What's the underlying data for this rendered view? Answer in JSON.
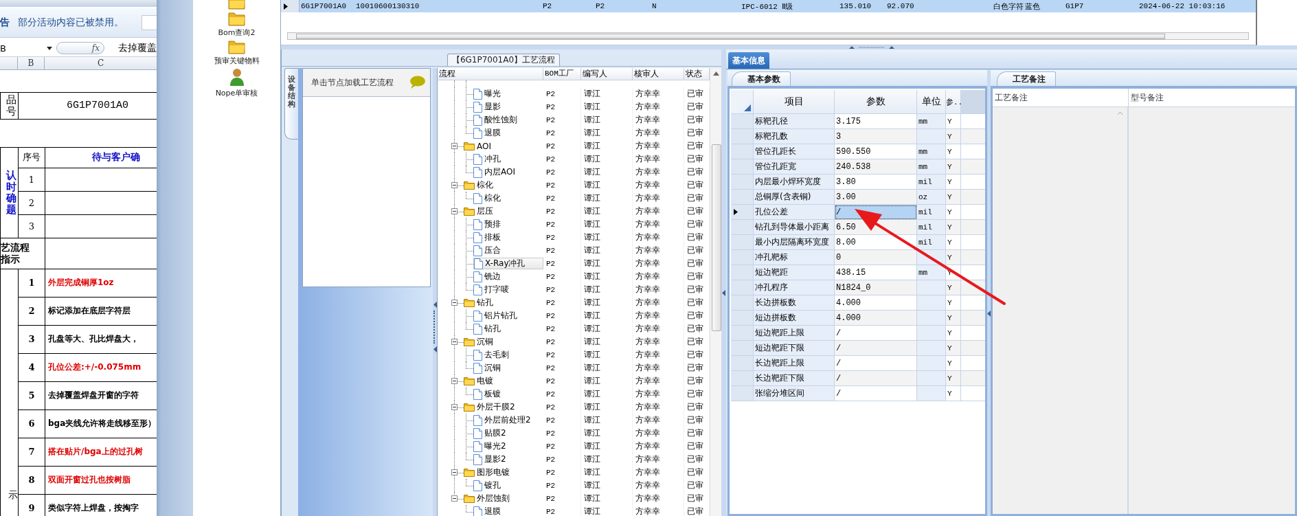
{
  "spreadsheet": {
    "warning": {
      "label": "告",
      "message": "部分活动内容已被禁用。"
    },
    "name_box": "B",
    "function_label": "fx",
    "formula": "去掉覆盖",
    "columns": [
      "B",
      "C"
    ],
    "part": {
      "label": "品号",
      "value": "6G1P7001A0"
    },
    "confirm": {
      "label": "认时确题",
      "number_header": "序号",
      "title_header": "待与客户确",
      "numbers": [
        "1",
        "2",
        "3"
      ]
    },
    "process_label": "艺流程指示",
    "instructions": {
      "label": "示",
      "items": [
        {
          "no": "1",
          "text": "外层完成铜厚1oz",
          "emphasis": true
        },
        {
          "no": "2",
          "text": "标记添加在底层字符层",
          "emphasis": false
        },
        {
          "no": "3",
          "text": "孔盘等大、孔比焊盘大，",
          "emphasis": false
        },
        {
          "no": "4",
          "text": "孔位公差:+/-0.075mm",
          "emphasis": true
        },
        {
          "no": "5",
          "text": "去掉覆盖焊盘开窗的字符",
          "emphasis": false
        },
        {
          "no": "6",
          "text": "bga夹线允许将走线移至形）",
          "emphasis": false
        },
        {
          "no": "7",
          "text": "搭在贴片/bga上的过孔树",
          "emphasis": true
        },
        {
          "no": "8",
          "text": "双面开窗过孔也按树脂",
          "emphasis": true
        },
        {
          "no": "9",
          "text": "类似字符上焊盘，按掏字",
          "emphasis": false
        }
      ]
    }
  },
  "launcher": [
    {
      "kind": "folder"
    },
    {
      "kind": "folder",
      "label": "Bom查询2"
    },
    {
      "kind": "folder",
      "label": "预审关键物料"
    },
    {
      "kind": "person",
      "label": "Nope单审核"
    }
  ],
  "records": {
    "rows": [
      {
        "selected": true,
        "cells": [
          "6G1P7001A0",
          "10010600130310",
          "P2",
          "P2",
          "N",
          "IPC-6012 Ⅱ级",
          "135.010",
          "92.070",
          "白色字符",
          "蓝色",
          "G1P7",
          "2024-06-22 10:03:16"
        ]
      }
    ]
  },
  "flow": {
    "title": "【6G1P7001A0】工艺流程",
    "side_tab": "设备结构",
    "hint": "单击节点加载工艺流程",
    "columns": [
      "流程",
      "BOM工厂",
      "编写人",
      "核审人",
      "状态"
    ],
    "nodes": [
      {
        "kind": "folder",
        "children": [
          {
            "kind": "step",
            "label": "曝光",
            "factory": "P2",
            "writer": "谭江",
            "reviewer": "方幸幸",
            "status": "已审",
            "selected": false
          },
          {
            "kind": "step",
            "label": "显影",
            "factory": "P2",
            "writer": "谭江",
            "reviewer": "方幸幸",
            "status": "已审",
            "selected": false
          },
          {
            "kind": "step",
            "label": "酸性蚀刻",
            "factory": "P2",
            "writer": "谭江",
            "reviewer": "方幸幸",
            "status": "已审",
            "selected": false
          },
          {
            "kind": "step",
            "label": "退膜",
            "factory": "P2",
            "writer": "谭江",
            "reviewer": "方幸幸",
            "status": "已审",
            "selected": false
          }
        ]
      },
      {
        "kind": "folder",
        "label": "AOI",
        "factory": "P2",
        "writer": "谭江",
        "reviewer": "方幸幸",
        "status": "已审",
        "selected": false,
        "expanded": true,
        "children": [
          {
            "kind": "step",
            "label": "冲孔",
            "factory": "P2",
            "writer": "谭江",
            "reviewer": "方幸幸",
            "status": "已审",
            "selected": false
          },
          {
            "kind": "step",
            "label": "内层AOI",
            "factory": "P2",
            "writer": "谭江",
            "reviewer": "方幸幸",
            "status": "已审",
            "selected": false
          }
        ]
      },
      {
        "kind": "folder",
        "label": "棕化",
        "factory": "P2",
        "writer": "谭江",
        "reviewer": "方幸幸",
        "status": "已审",
        "selected": false,
        "expanded": true,
        "children": [
          {
            "kind": "step",
            "label": "棕化",
            "factory": "P2",
            "writer": "谭江",
            "reviewer": "方幸幸",
            "status": "已审",
            "selected": false
          }
        ]
      },
      {
        "kind": "folder",
        "label": "层压",
        "factory": "P2",
        "writer": "谭江",
        "reviewer": "方幸幸",
        "status": "已审",
        "selected": false,
        "expanded": true,
        "children": [
          {
            "kind": "step",
            "label": "预排",
            "factory": "P2",
            "writer": "谭江",
            "reviewer": "方幸幸",
            "status": "已审",
            "selected": false
          },
          {
            "kind": "step",
            "label": "排板",
            "factory": "P2",
            "writer": "谭江",
            "reviewer": "方幸幸",
            "status": "已审",
            "selected": false
          },
          {
            "kind": "step",
            "label": "压合",
            "factory": "P2",
            "writer": "谭江",
            "reviewer": "方幸幸",
            "status": "已审",
            "selected": false
          },
          {
            "kind": "step",
            "label": "X-Ray冲孔",
            "factory": "P2",
            "writer": "谭江",
            "reviewer": "方幸幸",
            "status": "已审",
            "selected": true
          },
          {
            "kind": "step",
            "label": "铣边",
            "factory": "P2",
            "writer": "谭江",
            "reviewer": "方幸幸",
            "status": "已审",
            "selected": false
          },
          {
            "kind": "step",
            "label": "打字唛",
            "factory": "P2",
            "writer": "谭江",
            "reviewer": "方幸幸",
            "status": "已审",
            "selected": false
          }
        ]
      },
      {
        "kind": "folder",
        "label": "钻孔",
        "factory": "P2",
        "writer": "谭江",
        "reviewer": "方幸幸",
        "status": "已审",
        "selected": false,
        "expanded": true,
        "children": [
          {
            "kind": "step",
            "label": "铝片钻孔",
            "factory": "P2",
            "writer": "谭江",
            "reviewer": "方幸幸",
            "status": "已审",
            "selected": false
          },
          {
            "kind": "step",
            "label": "钻孔",
            "factory": "P2",
            "writer": "谭江",
            "reviewer": "方幸幸",
            "status": "已审",
            "selected": false
          }
        ]
      },
      {
        "kind": "folder",
        "label": "沉铜",
        "factory": "P2",
        "writer": "谭江",
        "reviewer": "方幸幸",
        "status": "已审",
        "selected": false,
        "expanded": true,
        "children": [
          {
            "kind": "step",
            "label": "去毛刺",
            "factory": "P2",
            "writer": "谭江",
            "reviewer": "方幸幸",
            "status": "已审",
            "selected": false
          },
          {
            "kind": "step",
            "label": "沉铜",
            "factory": "P2",
            "writer": "谭江",
            "reviewer": "方幸幸",
            "status": "已审",
            "selected": false
          }
        ]
      },
      {
        "kind": "folder",
        "label": "电镀",
        "factory": "P2",
        "writer": "谭江",
        "reviewer": "方幸幸",
        "status": "已审",
        "selected": false,
        "expanded": true,
        "children": [
          {
            "kind": "step",
            "label": "板镀",
            "factory": "P2",
            "writer": "谭江",
            "reviewer": "方幸幸",
            "status": "已审",
            "selected": false
          }
        ]
      },
      {
        "kind": "folder",
        "label": "外层干膜2",
        "factory": "P2",
        "writer": "谭江",
        "reviewer": "方幸幸",
        "status": "已审",
        "selected": false,
        "expanded": true,
        "children": [
          {
            "kind": "step",
            "label": "外层前处理2",
            "factory": "P2",
            "writer": "谭江",
            "reviewer": "方幸幸",
            "status": "已审",
            "selected": false
          },
          {
            "kind": "step",
            "label": "贴膜2",
            "factory": "P2",
            "writer": "谭江",
            "reviewer": "方幸幸",
            "status": "已审",
            "selected": false
          },
          {
            "kind": "step",
            "label": "曝光2",
            "factory": "P2",
            "writer": "谭江",
            "reviewer": "方幸幸",
            "status": "已审",
            "selected": false
          },
          {
            "kind": "step",
            "label": "显影2",
            "factory": "P2",
            "writer": "谭江",
            "reviewer": "方幸幸",
            "status": "已审",
            "selected": false
          }
        ]
      },
      {
        "kind": "folder",
        "label": "图形电镀",
        "factory": "P2",
        "writer": "谭江",
        "reviewer": "方幸幸",
        "status": "已审",
        "selected": false,
        "expanded": true,
        "children": [
          {
            "kind": "step",
            "label": "镀孔",
            "factory": "P2",
            "writer": "谭江",
            "reviewer": "方幸幸",
            "status": "已审",
            "selected": false
          }
        ]
      },
      {
        "kind": "folder",
        "label": "外层蚀刻",
        "factory": "P2",
        "writer": "谭江",
        "reviewer": "方幸幸",
        "status": "已审",
        "selected": false,
        "expanded": true,
        "children": [
          {
            "kind": "step",
            "label": "退膜",
            "factory": "P2",
            "writer": "谭江",
            "reviewer": "方幸幸",
            "status": "已审",
            "selected": false
          }
        ]
      }
    ]
  },
  "info": {
    "tabs": [
      {
        "label": "基本信息",
        "selected": true
      }
    ],
    "params": {
      "tabs": [
        {
          "label": "基本参数",
          "selected": true
        }
      ],
      "columns": [
        "项目",
        "参数",
        "单位",
        "参.."
      ],
      "rows": [
        {
          "item": "标靶孔径",
          "value": "3.175",
          "unit": "mm",
          "flag": "Y",
          "selected": false
        },
        {
          "item": "标靶孔数",
          "value": "3",
          "flag": "Y",
          "selected": false
        },
        {
          "item": "管位孔距长",
          "value": "590.550",
          "unit": "mm",
          "flag": "Y",
          "selected": false
        },
        {
          "item": "管位孔距宽",
          "value": "240.538",
          "unit": "mm",
          "flag": "Y",
          "selected": false
        },
        {
          "item": "内层最小焊环宽度",
          "value": "3.80",
          "unit": "mil",
          "flag": "Y",
          "selected": false
        },
        {
          "item": "总铜厚(含表铜)",
          "value": "3.00",
          "unit": "oz",
          "flag": "Y",
          "selected": false
        },
        {
          "item": "孔位公差",
          "value": "/",
          "unit": "mil",
          "flag": "Y",
          "selected": true
        },
        {
          "item": "钻孔到导体最小距离",
          "value": "6.50",
          "unit": "mil",
          "flag": "Y",
          "selected": false
        },
        {
          "item": "最小内层隔离环宽度",
          "value": "8.00",
          "unit": "mil",
          "flag": "Y",
          "selected": false
        },
        {
          "item": "冲孔靶标",
          "value": "0",
          "flag": "Y",
          "selected": false
        },
        {
          "item": "短边靶距",
          "value": "438.15",
          "unit": "mm",
          "flag": "Y",
          "selected": false
        },
        {
          "item": "冲孔程序",
          "value": "N1824_0",
          "flag": "Y",
          "selected": false
        },
        {
          "item": "长边拼板数",
          "value": "4.000",
          "flag": "Y",
          "selected": false
        },
        {
          "item": "短边拼板数",
          "value": "4.000",
          "flag": "Y",
          "selected": false
        },
        {
          "item": "短边靶距上限",
          "value": "/",
          "flag": "Y",
          "selected": false
        },
        {
          "item": "短边靶距下限",
          "value": "/",
          "flag": "Y",
          "selected": false
        },
        {
          "item": "长边靶距上限",
          "value": "/",
          "flag": "Y",
          "selected": false
        },
        {
          "item": "长边靶距下限",
          "value": "/",
          "flag": "Y",
          "selected": false
        },
        {
          "item": "张缩分堆区间",
          "value": "/",
          "flag": "Y",
          "selected": false
        }
      ]
    },
    "notes": {
      "tabs": [
        {
          "label": "工艺备注",
          "selected": true
        }
      ],
      "columns": [
        "工艺备注",
        "型号备注"
      ]
    }
  }
}
